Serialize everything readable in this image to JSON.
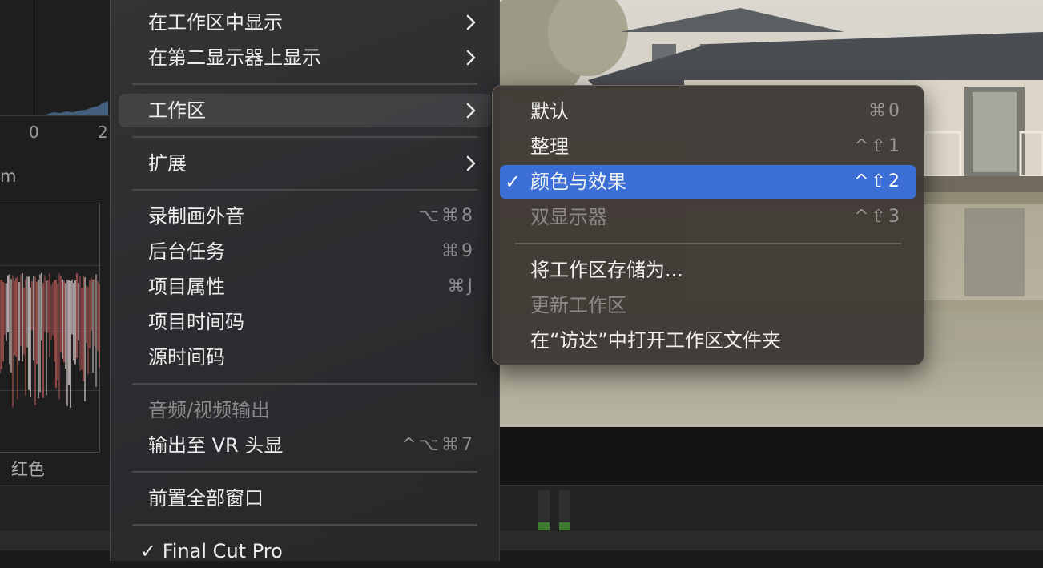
{
  "scope": {
    "axis_zero": "0",
    "axis_two": "2",
    "unit": "m",
    "channel_label": "红色"
  },
  "main_menu": {
    "items": [
      {
        "label": "在工作区中显示",
        "shortcut": "",
        "submenu": true
      },
      {
        "label": "在第二显示器上显示",
        "shortcut": "",
        "submenu": true
      },
      {
        "label": "工作区",
        "shortcut": "",
        "submenu": true,
        "highlighted": true
      },
      {
        "label": "扩展",
        "shortcut": "",
        "submenu": true
      },
      {
        "label": "录制画外音",
        "shortcut": "⌥⌘8"
      },
      {
        "label": "后台任务",
        "shortcut": "⌘9"
      },
      {
        "label": "项目属性",
        "shortcut": "⌘J"
      },
      {
        "label": "项目时间码",
        "shortcut": ""
      },
      {
        "label": "源时间码",
        "shortcut": ""
      },
      {
        "label": "音频/视频输出",
        "shortcut": "",
        "disabled": true
      },
      {
        "label": "输出至 VR 头显",
        "shortcut": "^⌥⌘7"
      },
      {
        "label": "前置全部窗口",
        "shortcut": ""
      },
      {
        "label": "✓ Final Cut Pro",
        "shortcut": ""
      }
    ]
  },
  "submenu": {
    "items": [
      {
        "label": "默认",
        "shortcut": "⌘0"
      },
      {
        "label": "整理",
        "shortcut": "^⇧1"
      },
      {
        "label": "颜色与效果",
        "shortcut": "^⇧2",
        "selected": true,
        "check": "✓"
      },
      {
        "label": "双显示器",
        "shortcut": "^⇧3",
        "disabled": true
      },
      {
        "label": "将工作区存储为...",
        "shortcut": ""
      },
      {
        "label": "更新工作区",
        "shortcut": "",
        "disabled": true
      },
      {
        "label": "在“访达”中打开工作区文件夹",
        "shortcut": ""
      }
    ]
  },
  "colors": {
    "selection": "#3b6fd6",
    "menu_bg": "#2e2f31",
    "submenu_bg": "#403a36",
    "meter_green": "#3f7a33"
  }
}
